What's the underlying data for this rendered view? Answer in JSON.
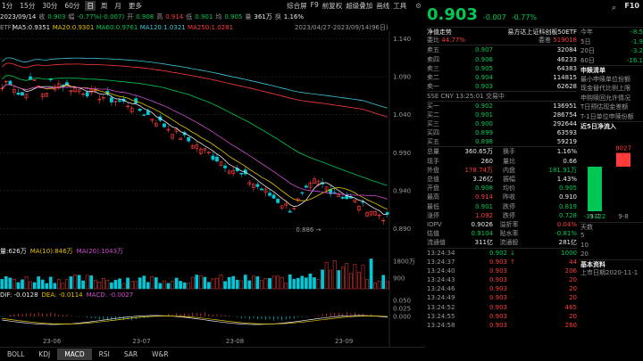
{
  "toolbar": {
    "periods": [
      "1分",
      "15分",
      "30分",
      "60分",
      "日",
      "周",
      "月",
      "更多"
    ],
    "active_period": "日",
    "right_items": [
      "综合屏",
      "F9",
      "前复权",
      "超级叠加",
      "画线",
      "工具"
    ]
  },
  "infobar": {
    "date": "2023/09/14",
    "close_label": "收",
    "close": "0.903",
    "change_label": "幅",
    "change": "-0.77%(-0.007)",
    "open_label": "开",
    "open": "0.908",
    "high_label": "高",
    "high": "0.914",
    "low_label": "低",
    "low": "0.901",
    "avg_label": "均",
    "avg": "0.905",
    "vol_label": "量",
    "vol": "361万",
    "turn_label": "换",
    "turn": "1.16%"
  },
  "ma_line": {
    "ticker": "ETF]",
    "items": [
      {
        "label": "MA5",
        "value": "0.9351",
        "color": "#e8e8e8"
      },
      {
        "label": "MA20",
        "value": "0.9301",
        "color": "#e6c200"
      },
      {
        "label": "MA60",
        "value": "0.9761",
        "color": "#00c853"
      },
      {
        "label": "MA120",
        "value": "1.0321",
        "color": "#3cc8d8"
      },
      {
        "label": "MA250",
        "value": "1.0281",
        "color": "#ff3b3b"
      }
    ],
    "range": "2023/04/27-2023/09/14(96日)"
  },
  "price_axis": [
    "1.140",
    "1.090",
    "1.040",
    "0.990",
    "0.940",
    "0.890"
  ],
  "low_mark": "0.886",
  "volume": {
    "items": [
      {
        "label": "量:",
        "value": "626万",
        "color": "#e8e8e8"
      },
      {
        "label": "MA(10):",
        "value": "846万",
        "color": "#e6c200"
      },
      {
        "label": "MA(20):",
        "value": "1043万",
        "color": "#d04cd0"
      }
    ],
    "axis": [
      "1800万",
      "900"
    ]
  },
  "macd": {
    "items": [
      {
        "label": "DIF:",
        "value": "-0.0128",
        "color": "#e8e8e8"
      },
      {
        "label": "DEA:",
        "value": "-0.0114",
        "color": "#e6c200"
      },
      {
        "label": "MACD:",
        "value": "-0.0027",
        "color": "#d04cd0"
      }
    ],
    "axis": [
      "0.050",
      "0.025",
      "0.000"
    ]
  },
  "date_axis": [
    "23-06",
    "23-07",
    "23-08",
    "23-09"
  ],
  "indicator_tabs": [
    "BOLL",
    "KDJ",
    "MACD",
    "RSI",
    "SAR",
    "W&R"
  ],
  "active_indicator": "MACD",
  "quote": {
    "price": "0.903",
    "change": "-0.007",
    "change_pct": "-0.77%",
    "net_label": "净值走势",
    "name": "易方达上证科创板50ETF",
    "ratio_label": "委比",
    "ratio": "44.77%",
    "diff_label": "委差",
    "diff": "519018",
    "asks": [
      {
        "label": "卖五",
        "price": "0.907",
        "vol": "32084"
      },
      {
        "label": "卖四",
        "price": "0.906",
        "vol": "46233"
      },
      {
        "label": "卖三",
        "price": "0.905",
        "vol": "64383"
      },
      {
        "label": "卖二",
        "price": "0.904",
        "vol": "114815"
      },
      {
        "label": "卖一",
        "price": "0.903",
        "vol": "62628"
      }
    ],
    "status": "SSE  CNY  13:25:01  交易中",
    "bids": [
      {
        "label": "买一",
        "price": "0.902",
        "vol": "136951"
      },
      {
        "label": "买二",
        "price": "0.901",
        "vol": "286754"
      },
      {
        "label": "买三",
        "price": "0.900",
        "vol": "292644"
      },
      {
        "label": "买四",
        "price": "0.899",
        "vol": "63593"
      },
      {
        "label": "买五",
        "price": "0.898",
        "vol": "59219"
      }
    ],
    "stats": [
      {
        "l1": "总量",
        "v1": "360.65万",
        "c1": "white",
        "l2": "换手",
        "v2": "1.16%",
        "c2": "white"
      },
      {
        "l1": "现手",
        "v1": "260",
        "c1": "white",
        "l2": "量比",
        "v2": "0.66",
        "c2": "white"
      },
      {
        "l1": "外盘",
        "v1": "178.74万",
        "c1": "red",
        "l2": "内盘",
        "v2": "181.91万",
        "c2": "green"
      },
      {
        "l1": "总值",
        "v1": "3.26亿",
        "c1": "white",
        "l2": "振幅",
        "v2": "1.43%",
        "c2": "white"
      },
      {
        "l1": "开盘",
        "v1": "0.908",
        "c1": "green",
        "l2": "均价",
        "v2": "0.905",
        "c2": "green"
      },
      {
        "l1": "最高",
        "v1": "0.914",
        "c1": "red",
        "l2": "昨收",
        "v2": "0.910",
        "c2": "white"
      },
      {
        "l1": "最低",
        "v1": "0.901",
        "c1": "green",
        "l2": "跌停",
        "v2": "0.819",
        "c2": "green"
      },
      {
        "l1": "涨停",
        "v1": "1.092",
        "c1": "red",
        "l2": "跌停",
        "v2": "0.728",
        "c2": "green"
      },
      {
        "l1": "IOPV",
        "v1": "0.9026",
        "c1": "white",
        "l2": "溢折率",
        "v2": "0.04%",
        "c2": "red"
      },
      {
        "l1": "估值",
        "v1": "0.9104",
        "c1": "green",
        "l2": "贴水率",
        "v2": "-0.81%",
        "c2": "green"
      },
      {
        "l1": "流通值",
        "v1": "311亿",
        "c1": "white",
        "l2": "流通股",
        "v2": "281亿",
        "c2": "white"
      }
    ],
    "ticks": [
      {
        "time": "13:24:34",
        "price": "0.902",
        "arrow": "↓",
        "vol": "1000",
        "color": "green"
      },
      {
        "time": "13:24:37",
        "price": "0.903",
        "arrow": "↑",
        "vol": "44",
        "color": "red"
      },
      {
        "time": "13:24:40",
        "price": "0.903",
        "arrow": "",
        "vol": "206",
        "color": "red"
      },
      {
        "time": "13:24:43",
        "price": "0.903",
        "arrow": "",
        "vol": "20",
        "color": "red"
      },
      {
        "time": "13:24:46",
        "price": "0.903",
        "arrow": "",
        "vol": "20",
        "color": "red"
      },
      {
        "time": "13:24:49",
        "price": "0.903",
        "arrow": "",
        "vol": "20",
        "color": "red"
      },
      {
        "time": "13:24:52",
        "price": "0.903",
        "arrow": "",
        "vol": "465",
        "color": "red"
      },
      {
        "time": "13:24:55",
        "price": "0.903",
        "arrow": "",
        "vol": "20",
        "color": "red"
      },
      {
        "time": "13:24:58",
        "price": "0.903",
        "arrow": "",
        "vol": "260",
        "color": "red"
      }
    ]
  },
  "side": {
    "periods": [
      {
        "label": "今年",
        "value": "-8.5"
      },
      {
        "label": "5日",
        "value": "-1.9"
      },
      {
        "label": "20日",
        "value": "-3.2"
      },
      {
        "label": "60日",
        "value": "-16.1"
      }
    ],
    "section": "申赎清单",
    "lines": [
      "最小申赎单位份额",
      "现金替代比例上限",
      "申购赎回允许情况",
      "T日预估现金差额",
      "T-1日单位申赎份额"
    ],
    "flow_title": "近5日净流入",
    "flow_bars": [
      {
        "label": "9-7",
        "value": -31122,
        "text": "-31122"
      },
      {
        "label": "9-8",
        "value": 8027,
        "text": "8027"
      }
    ],
    "days_label": "天数",
    "days": [
      "5",
      "10",
      "20"
    ],
    "basic_title": "基本资料",
    "listing": "上市日期2020-11-1"
  }
}
